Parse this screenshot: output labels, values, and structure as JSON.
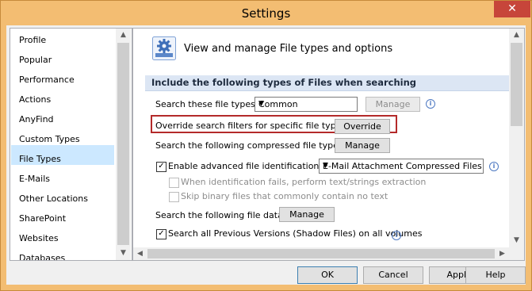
{
  "window": {
    "title": "Settings",
    "close_glyph": "✕"
  },
  "nav": {
    "items": [
      {
        "label": "Profile"
      },
      {
        "label": "Popular"
      },
      {
        "label": "Performance"
      },
      {
        "label": "Actions"
      },
      {
        "label": "AnyFind"
      },
      {
        "label": "Custom Types"
      },
      {
        "label": "File Types"
      },
      {
        "label": "E-Mails"
      },
      {
        "label": "Other Locations"
      },
      {
        "label": "SharePoint"
      },
      {
        "label": "Websites"
      },
      {
        "label": "Databases"
      }
    ],
    "selected": "File Types"
  },
  "header": {
    "text": "View and manage File types and options",
    "icon": "gear-settings-icon"
  },
  "section": {
    "title": "Include the following types of Files when searching"
  },
  "settings": {
    "file_types_label": "Search these file types:",
    "file_types_value": "Common",
    "manage_disabled": "Manage",
    "override_label": "Override search filters for specific file types:",
    "override_button": "Override",
    "compressed_label": "Search the following compressed file types:",
    "compressed_button": "Manage",
    "advanced_label": "Enable advanced file identification for:",
    "advanced_value": "E-Mail Attachment Compressed Files",
    "when_failed_label": "When identification fails, perform text/strings extraction",
    "skip_binary_label": "Skip binary files that commonly contain no text",
    "file_data_label": "Search the following file data:",
    "file_data_button": "Manage",
    "shadow_label": "Search all Previous Versions (Shadow Files) on all volumes"
  },
  "footer": {
    "ok": "OK",
    "cancel": "Cancel",
    "apply": "Apply",
    "help": "Help"
  },
  "colors": {
    "highlight_border": "#b42a2a",
    "section_bg": "#dce6f4",
    "nav_selected": "#cce8ff",
    "title_bar": "#f3bd72"
  }
}
